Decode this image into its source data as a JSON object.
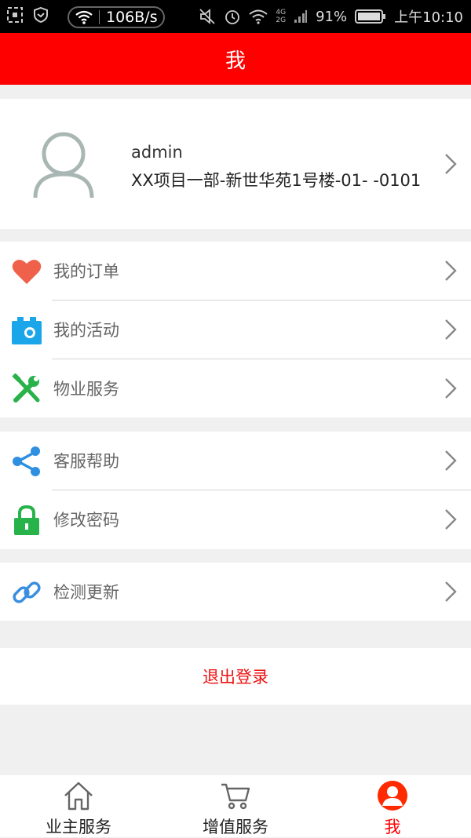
{
  "status_bar": {
    "net_speed": "106B/s",
    "network_tags": [
      "4G",
      "2G"
    ],
    "battery": "91%",
    "time": "上午10:10"
  },
  "header": {
    "title": "我"
  },
  "profile": {
    "username": "admin",
    "address": "XX项目一部-新世华苑1号楼-01- -0101"
  },
  "menu": {
    "orders": {
      "label": "我的订单",
      "icon": "heart-icon",
      "color": "#f0614c"
    },
    "activities": {
      "label": "我的活动",
      "icon": "camera-bag-icon",
      "color": "#1aa6e8"
    },
    "property": {
      "label": "物业服务",
      "icon": "tools-icon",
      "color": "#2ab24a"
    },
    "help": {
      "label": "客服帮助",
      "icon": "share-icon",
      "color": "#2f8fe0"
    },
    "password": {
      "label": "修改密码",
      "icon": "lock-icon",
      "color": "#27b24a"
    },
    "update": {
      "label": "检测更新",
      "icon": "link-icon",
      "color": "#3a8ee0"
    }
  },
  "logout_label": "退出登录",
  "tabs": [
    {
      "label": "业主服务",
      "icon": "home-icon"
    },
    {
      "label": "增值服务",
      "icon": "cart-icon"
    },
    {
      "label": "我",
      "icon": "user-icon",
      "active": true
    }
  ],
  "colors": {
    "accent": "#ff0000",
    "background": "#f0f0f0"
  }
}
